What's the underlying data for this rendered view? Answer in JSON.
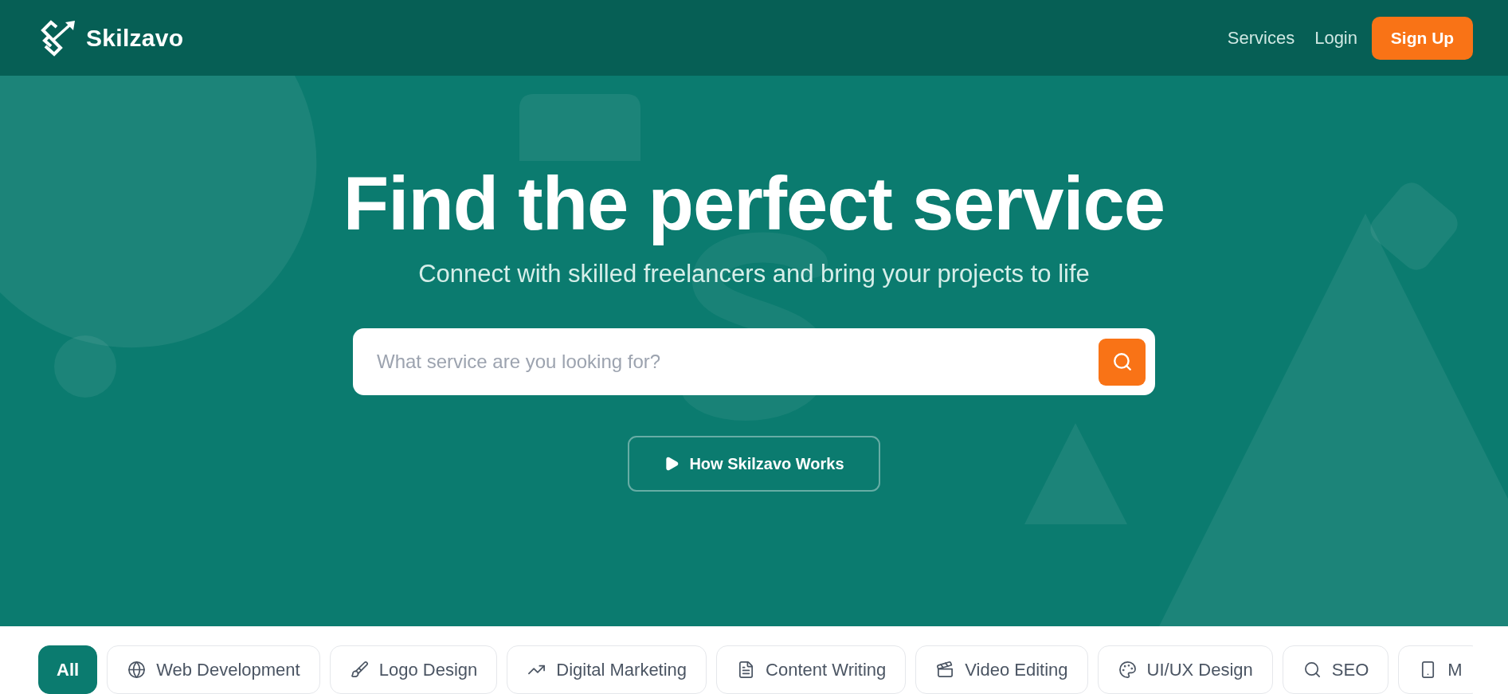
{
  "header": {
    "logo": "Skilzavo",
    "nav": [
      "Services",
      "Login"
    ],
    "signup_button": "Sign Up"
  },
  "hero": {
    "title": "Find the perfect service",
    "subtitle": "Connect with skilled freelancers and bring your projects to life",
    "search": {
      "placeholder": "What service are you looking for?"
    },
    "video_button": "How Skilzavo Works"
  },
  "categories": [
    {
      "label": "All",
      "selected": true
    },
    {
      "label": "Web Development",
      "selected": false
    },
    {
      "label": "Logo Design",
      "selected": false
    },
    {
      "label": "Digital Marketing",
      "selected": false
    },
    {
      "label": "Content Writing",
      "selected": false
    },
    {
      "label": "Video Editing",
      "selected": false
    },
    {
      "label": "UI/UX Design",
      "selected": false
    },
    {
      "label": "SEO",
      "selected": false
    },
    {
      "label": "M",
      "selected": false
    }
  ]
}
